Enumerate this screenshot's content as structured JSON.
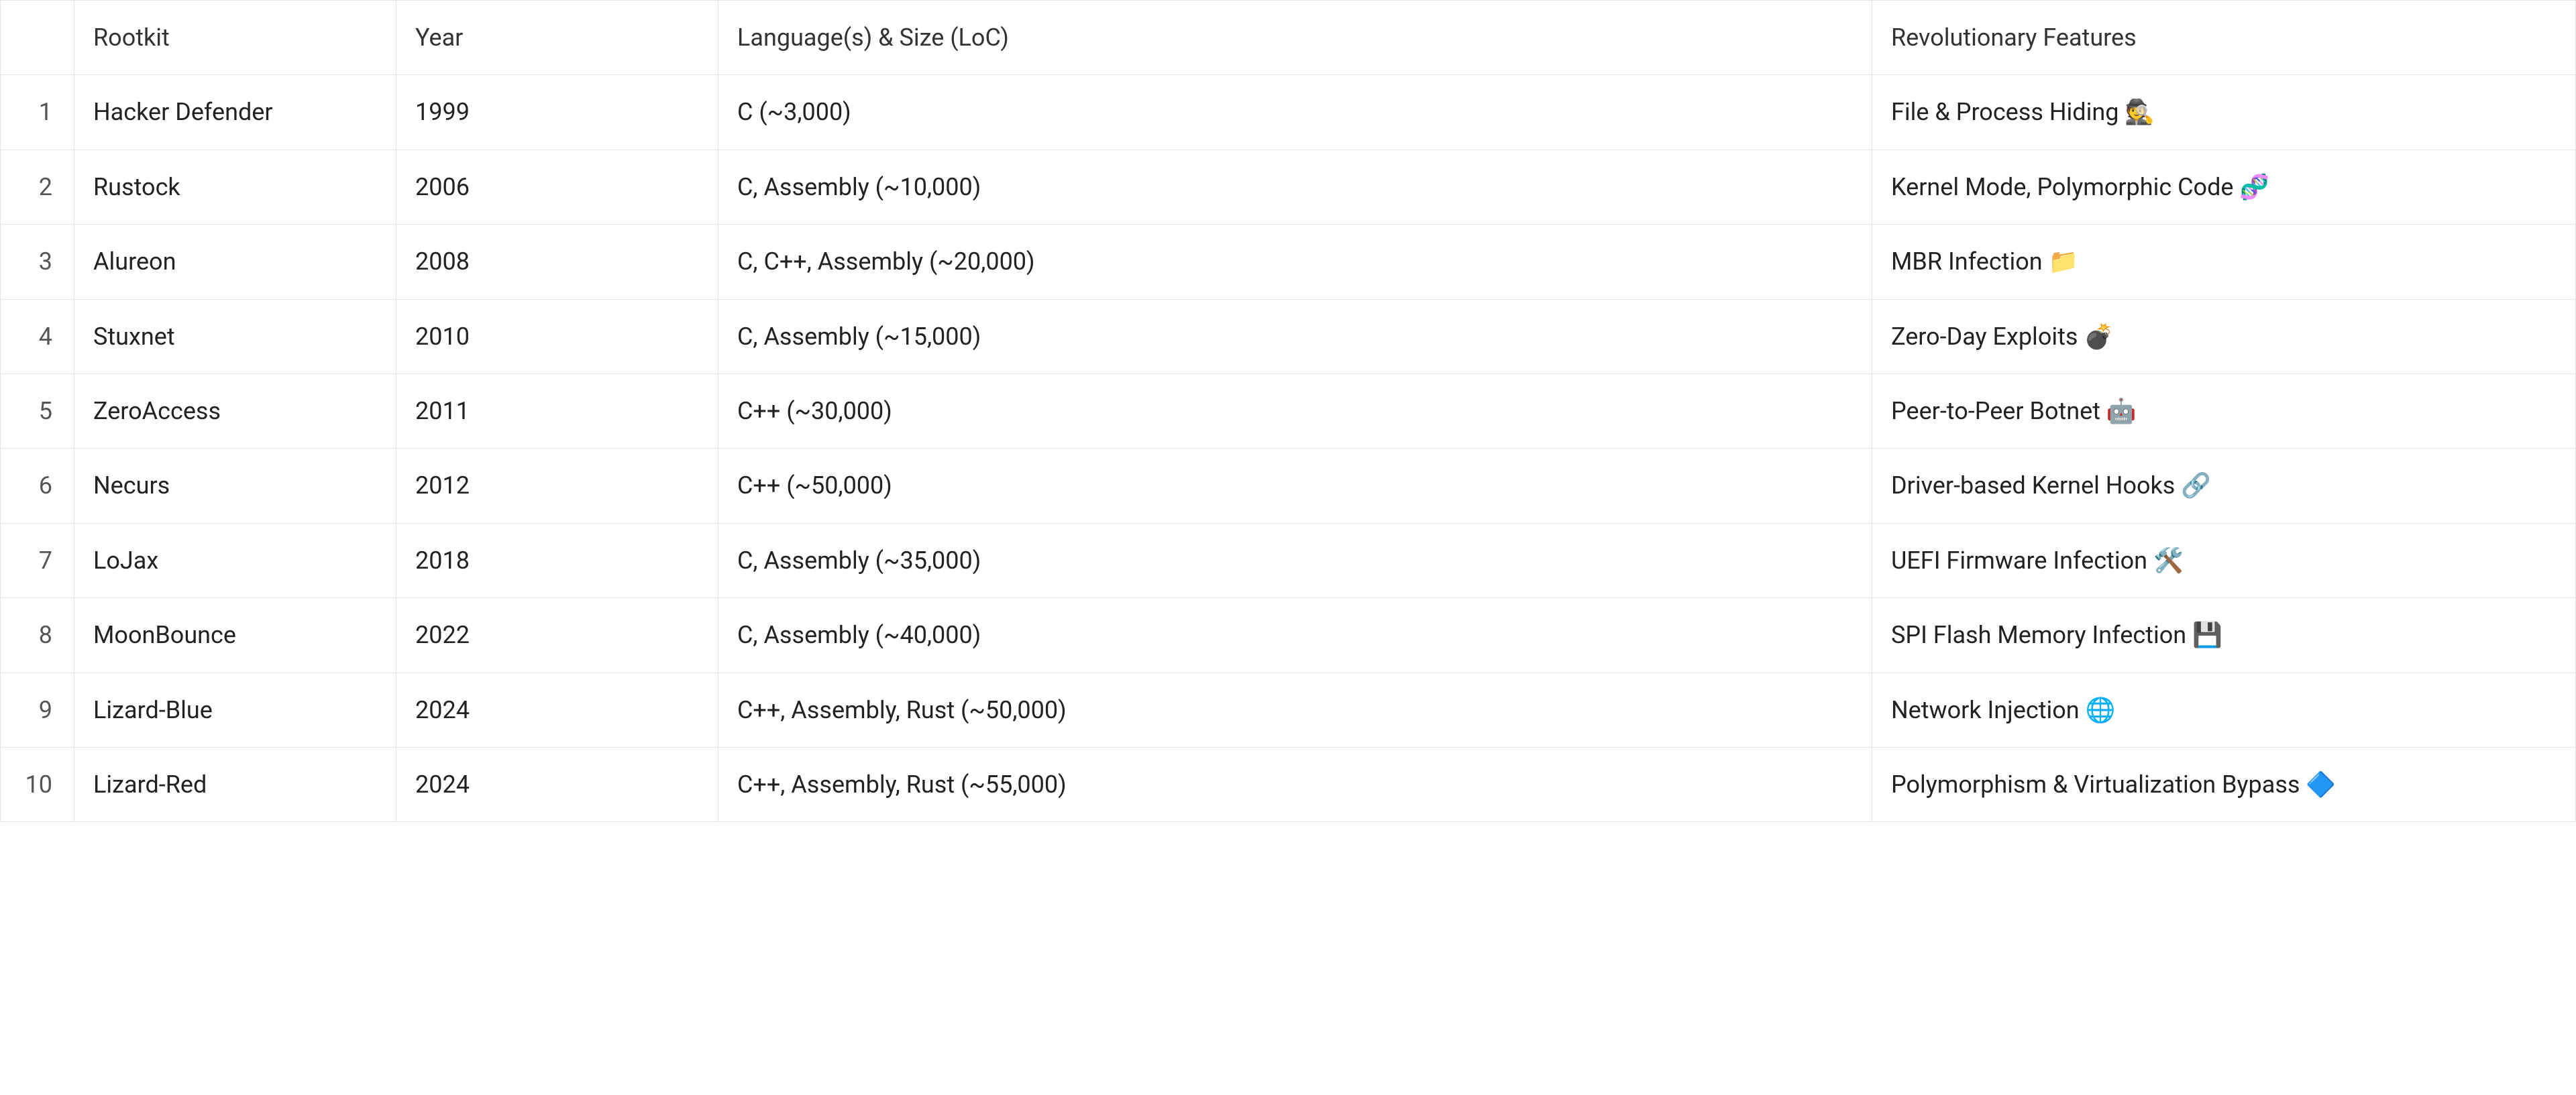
{
  "table": {
    "headers": {
      "index": "",
      "rootkit": "Rootkit",
      "year": "Year",
      "lang": "Language(s) & Size (LoC)",
      "features": "Revolutionary Features"
    },
    "rows": [
      {
        "index": "1",
        "rootkit": "Hacker Defender",
        "year": "1999",
        "lang": "C (~3,000)",
        "features": "File & Process Hiding 🕵️"
      },
      {
        "index": "2",
        "rootkit": "Rustock",
        "year": "2006",
        "lang": "C, Assembly (~10,000)",
        "features": "Kernel Mode, Polymorphic Code 🧬"
      },
      {
        "index": "3",
        "rootkit": "Alureon",
        "year": "2008",
        "lang": "C, C++, Assembly (~20,000)",
        "features": "MBR Infection 📁"
      },
      {
        "index": "4",
        "rootkit": "Stuxnet",
        "year": "2010",
        "lang": "C, Assembly (~15,000)",
        "features": "Zero-Day Exploits 💣"
      },
      {
        "index": "5",
        "rootkit": "ZeroAccess",
        "year": "2011",
        "lang": "C++ (~30,000)",
        "features": "Peer-to-Peer Botnet 🤖"
      },
      {
        "index": "6",
        "rootkit": "Necurs",
        "year": "2012",
        "lang": "C++ (~50,000)",
        "features": "Driver-based Kernel Hooks 🔗"
      },
      {
        "index": "7",
        "rootkit": "LoJax",
        "year": "2018",
        "lang": "C, Assembly (~35,000)",
        "features": "UEFI Firmware Infection 🛠️"
      },
      {
        "index": "8",
        "rootkit": "MoonBounce",
        "year": "2022",
        "lang": "C, Assembly (~40,000)",
        "features": "SPI Flash Memory Infection 💾"
      },
      {
        "index": "9",
        "rootkit": "Lizard-Blue",
        "year": "2024",
        "lang": "C++, Assembly, Rust (~50,000)",
        "features": "Network Injection 🌐"
      },
      {
        "index": "10",
        "rootkit": "Lizard-Red",
        "year": "2024",
        "lang": "C++, Assembly, Rust (~55,000)",
        "features": "Polymorphism & Virtualization Bypass 🔷"
      }
    ]
  }
}
